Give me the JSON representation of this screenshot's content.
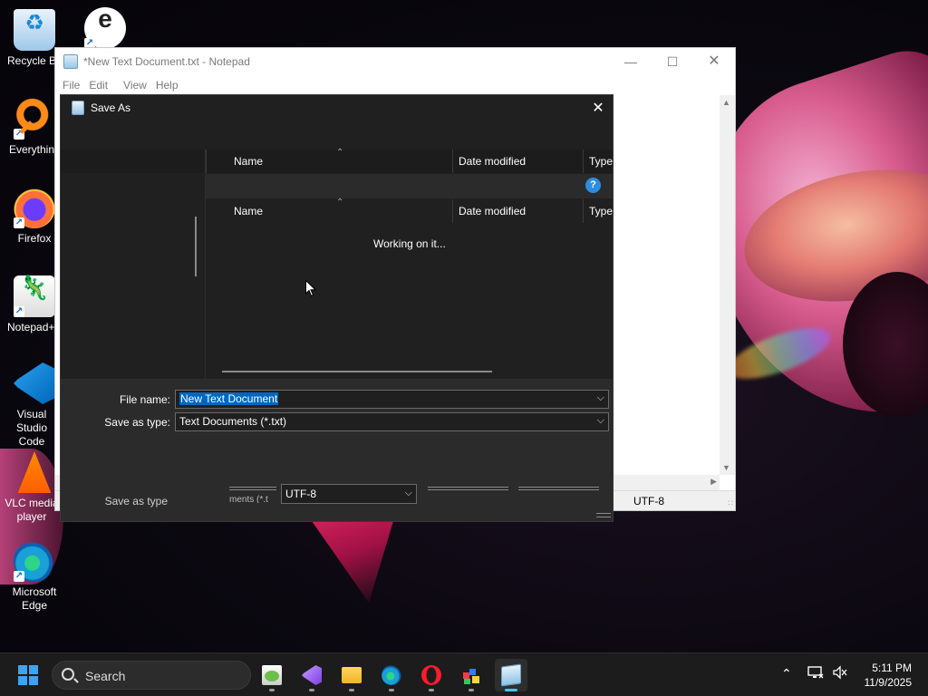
{
  "desktop": {
    "icons": [
      {
        "label": "Recycle Bin",
        "icon": "recycle-bin-icon"
      },
      {
        "label": "",
        "icon": "e-app-icon"
      },
      {
        "label": "Everything",
        "icon": "everything-search-icon"
      },
      {
        "label": "Firefox",
        "icon": "firefox-icon"
      },
      {
        "label": "Notepad++",
        "icon": "notepad-plus-plus-icon"
      },
      {
        "label": "Visual Studio Code",
        "icon": "vscode-icon"
      },
      {
        "label": "VLC media player",
        "icon": "vlc-icon"
      },
      {
        "label": "Microsoft Edge",
        "icon": "edge-icon"
      }
    ]
  },
  "notepad": {
    "title": "*New Text Document.txt - Notepad",
    "menu": [
      "File",
      "Edit",
      "View",
      "Help"
    ],
    "status_encoding": "UTF-8"
  },
  "save_as": {
    "title": "Save As",
    "columns": {
      "name": "Name",
      "date_modified": "Date modified",
      "type": "Type"
    },
    "loading_text": "Working on it...",
    "file_name_label": "File name:",
    "file_name_value": "New Text Document",
    "save_as_type_label": "Save as type:",
    "save_as_type_value": "Text Documents (*.txt)",
    "ghost_label": "Save as type",
    "ghost_partial_text": "ments (*.t",
    "encoding_value": "UTF-8",
    "help_glyph": "?"
  },
  "taskbar": {
    "search_placeholder": "Search",
    "apps": [
      {
        "name": "Notepad++",
        "icon": "notepad-plus-plus-icon",
        "active": false
      },
      {
        "name": "Visual Studio",
        "icon": "visual-studio-icon",
        "active": false
      },
      {
        "name": "File Explorer",
        "icon": "file-explorer-icon",
        "active": false
      },
      {
        "name": "Microsoft Edge",
        "icon": "edge-icon",
        "active": false
      },
      {
        "name": "Opera",
        "icon": "opera-icon",
        "active": false
      },
      {
        "name": "Paint app",
        "icon": "paint-icon",
        "active": false
      },
      {
        "name": "Notepad",
        "icon": "notepad-icon",
        "active": true
      }
    ],
    "time": "5:11 PM",
    "date": "11/9/2025"
  },
  "colors": {
    "accent": "#0067c0",
    "help_blue": "#2d8de0",
    "dialog_bg": "#202020",
    "taskbar_bg": "#1c1c1c",
    "active_indicator": "#4cc2ff"
  }
}
